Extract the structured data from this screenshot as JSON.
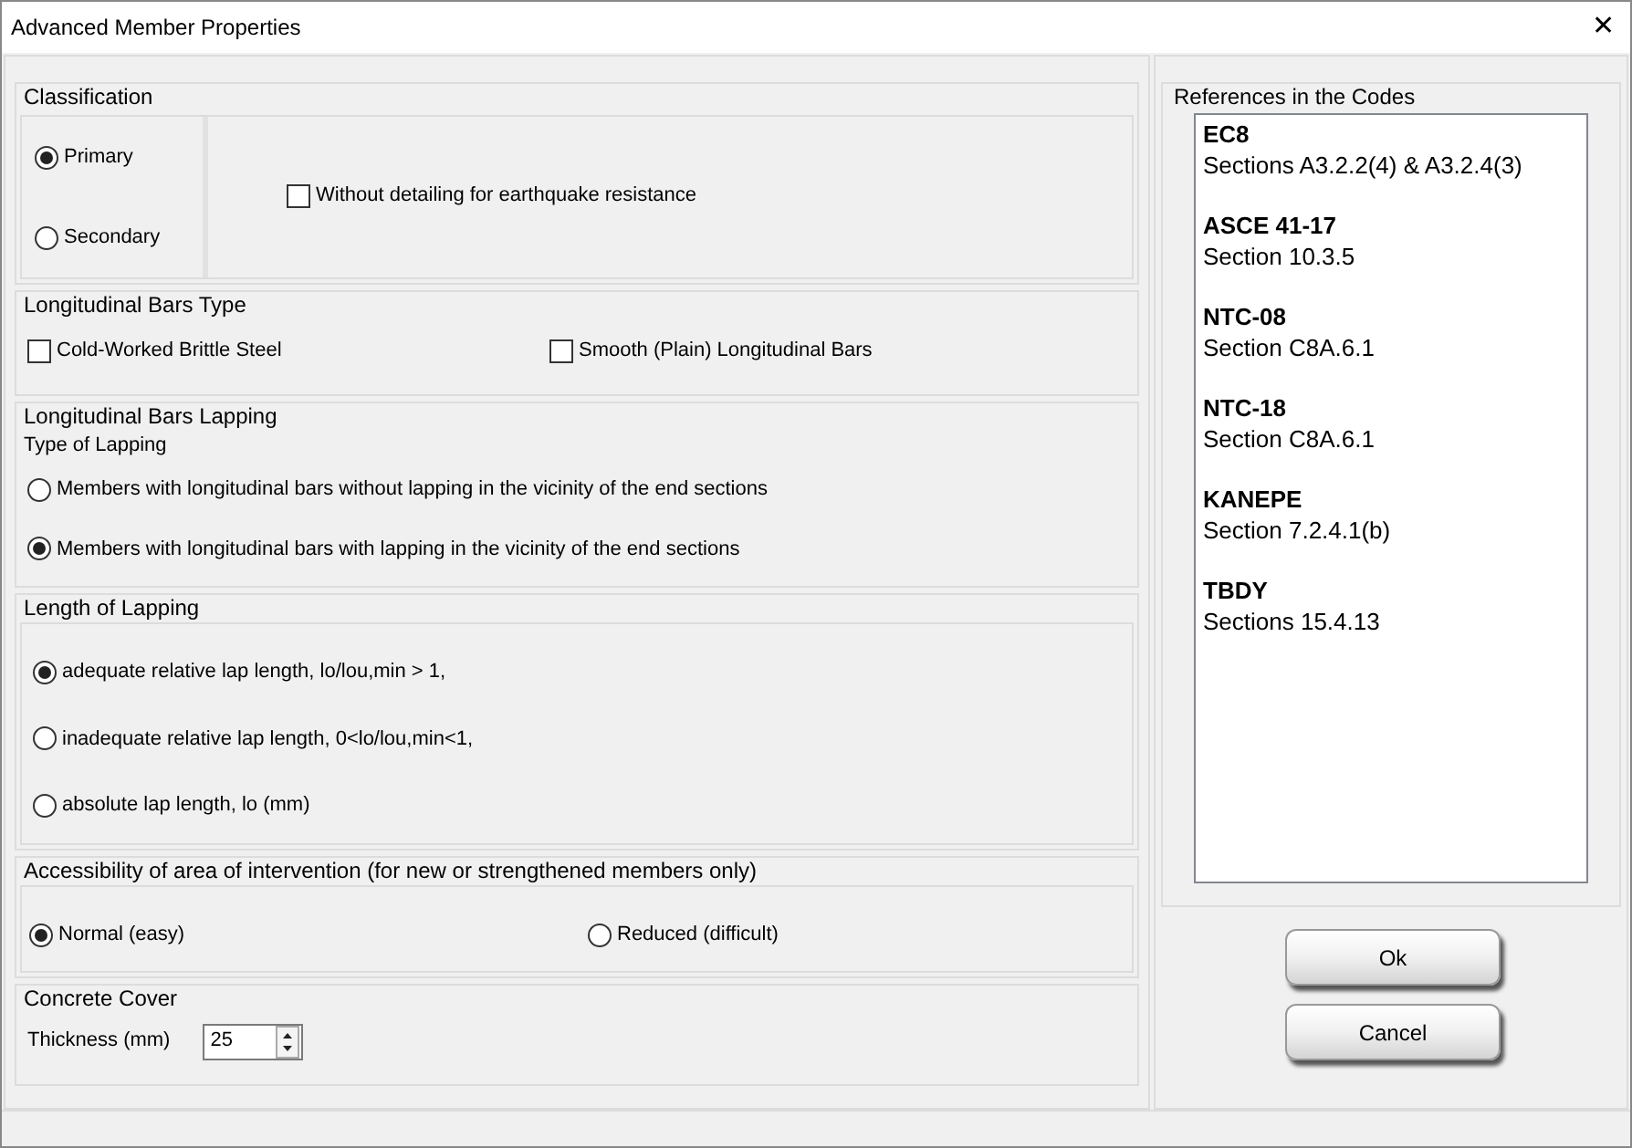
{
  "window": {
    "title": "Advanced Member Properties",
    "close": "✕"
  },
  "classification": {
    "title": "Classification",
    "options": [
      {
        "label": "Primary",
        "selected": true
      },
      {
        "label": "Secondary",
        "selected": false
      }
    ],
    "checkbox": {
      "label": "Without detailing for earthquake resistance",
      "checked": false
    }
  },
  "bars_type": {
    "title": "Longitudinal Bars Type",
    "checkboxes": [
      {
        "label": "Cold-Worked Brittle Steel",
        "checked": false
      },
      {
        "label": "Smooth (Plain) Longitudinal Bars",
        "checked": false
      }
    ]
  },
  "lapping": {
    "title": "Longitudinal Bars Lapping",
    "subtitle": "Type of Lapping",
    "options": [
      {
        "label": "Members with longitudinal bars without lapping in the vicinity of the end sections",
        "selected": false
      },
      {
        "label": "Members with longitudinal bars with lapping in the vicinity of the end sections",
        "selected": true
      }
    ]
  },
  "lap_length": {
    "title": "Length of Lapping",
    "options": [
      {
        "label": "adequate relative lap length,  lo/lou,min > 1,",
        "selected": true
      },
      {
        "label": "inadequate relative lap length,  0<lo/lou,min<1,",
        "selected": false
      },
      {
        "label": "absolute lap length, lo (mm)",
        "selected": false
      }
    ]
  },
  "accessibility": {
    "title": "Accessibility of area of intervention (for new or strengthened members only)",
    "options": [
      {
        "label": "Normal (easy)",
        "selected": true
      },
      {
        "label": "Reduced (difficult)",
        "selected": false
      }
    ]
  },
  "cover": {
    "title": "Concrete Cover",
    "label": "Thickness (mm)",
    "value": "25"
  },
  "references": {
    "title": "References in the Codes",
    "items": [
      {
        "code": "EC8",
        "section": "Sections A3.2.2(4) & A3.2.4(3)"
      },
      {
        "code": "ASCE 41-17",
        "section": "Section 10.3.5"
      },
      {
        "code": "NTC-08",
        "section": "Section C8A.6.1"
      },
      {
        "code": "NTC-18",
        "section": "Section C8A.6.1"
      },
      {
        "code": "KANEPE",
        "section": "Section 7.2.4.1(b)"
      },
      {
        "code": "TBDY",
        "section": "Sections 15.4.13"
      }
    ]
  },
  "buttons": [
    "Ok",
    "Cancel"
  ]
}
